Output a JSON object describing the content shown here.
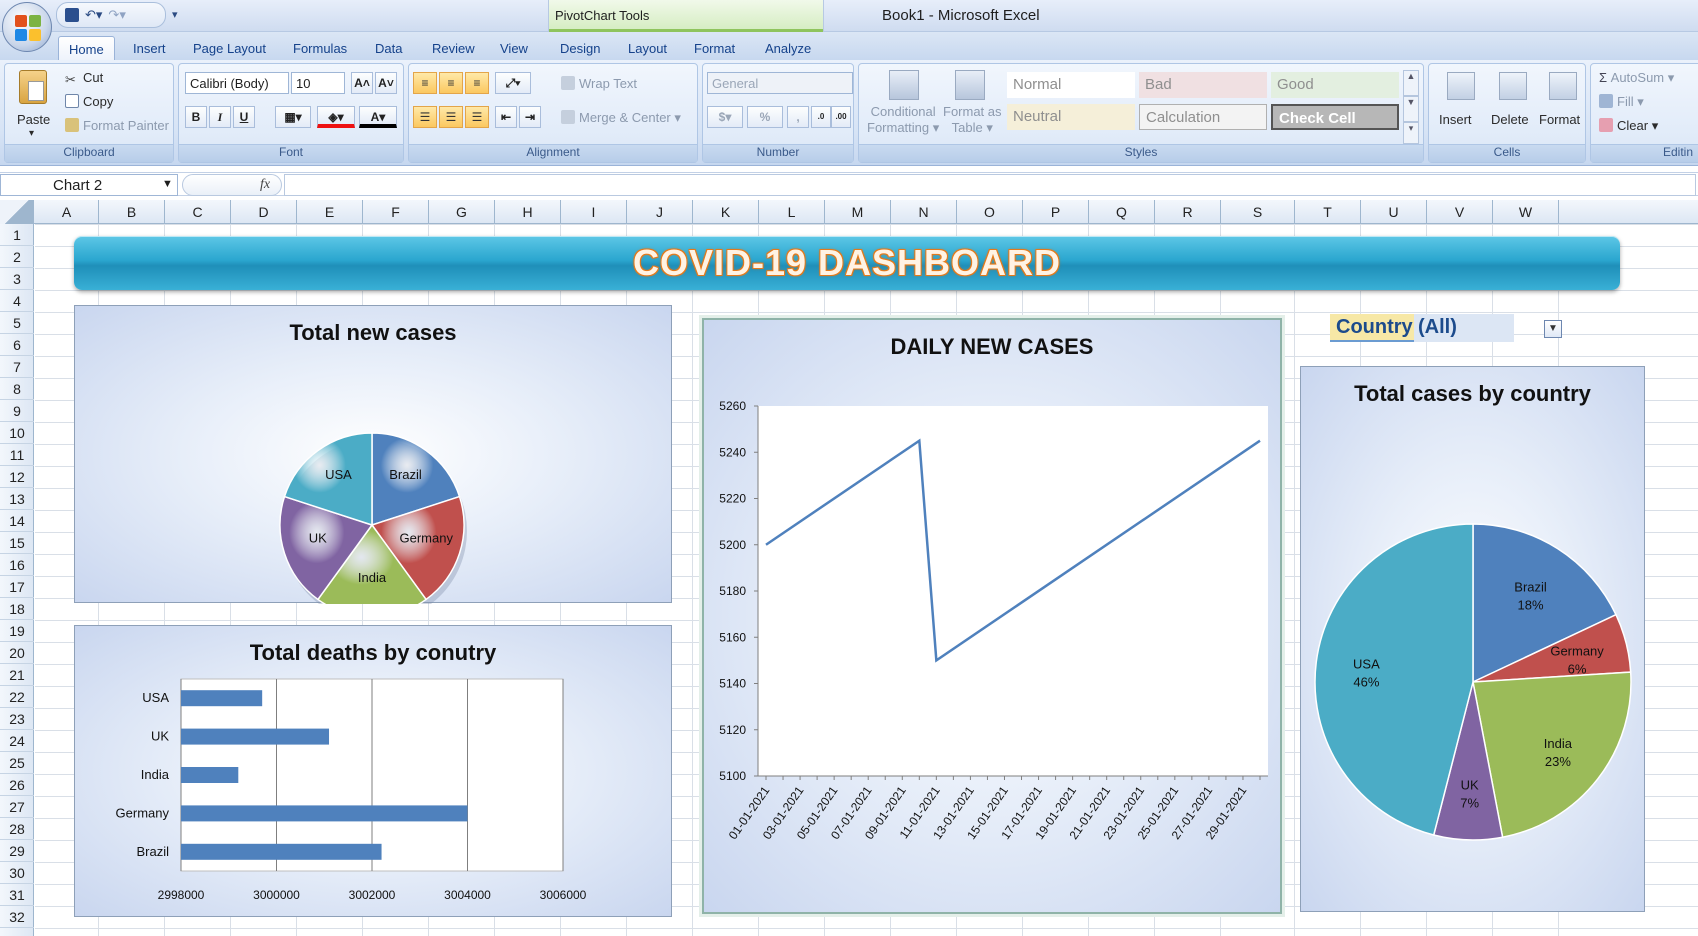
{
  "window": {
    "title": "Book1 - Microsoft Excel",
    "contextual_tools": "PivotChart Tools"
  },
  "tabs": [
    {
      "label": "Home",
      "active": true
    },
    {
      "label": "Insert"
    },
    {
      "label": "Page Layout"
    },
    {
      "label": "Formulas"
    },
    {
      "label": "Data"
    },
    {
      "label": "Review"
    },
    {
      "label": "View"
    },
    {
      "label": "Design"
    },
    {
      "label": "Layout"
    },
    {
      "label": "Format"
    },
    {
      "label": "Analyze"
    }
  ],
  "ribbon": {
    "clipboard": {
      "label": "Clipboard",
      "paste": "Paste",
      "cut": "Cut",
      "copy": "Copy",
      "format_painter": "Format Painter"
    },
    "font": {
      "label": "Font",
      "family": "Calibri (Body)",
      "size": "10",
      "bold": "B",
      "italic": "I",
      "underline": "U",
      "grow": "A˄",
      "shrink": "A˅"
    },
    "alignment": {
      "label": "Alignment",
      "wrap_text": "Wrap Text",
      "merge_center": "Merge & Center"
    },
    "number": {
      "label": "Number",
      "format": "General",
      "percent": "%"
    },
    "styles": {
      "label": "Styles",
      "conditional": [
        "Conditional",
        "Formatting"
      ],
      "format_table": [
        "Format as",
        "Table"
      ],
      "normal": "Normal",
      "bad": "Bad",
      "good": "Good",
      "neutral": "Neutral",
      "calculation": "Calculation",
      "check_cell": "Check Cell"
    },
    "cells": {
      "label": "Cells",
      "insert": "Insert",
      "delete": "Delete",
      "format": "Format"
    },
    "editing": {
      "label": "Editin",
      "autosum": "AutoSum",
      "fill": "Fill",
      "clear": "Clear"
    }
  },
  "formula_bar": {
    "name_box": "Chart 2",
    "fx": "fx"
  },
  "columns": [
    "A",
    "B",
    "C",
    "D",
    "E",
    "F",
    "G",
    "H",
    "I",
    "J",
    "K",
    "L",
    "M",
    "N",
    "O",
    "P",
    "Q",
    "R",
    "S",
    "T",
    "U",
    "V",
    "W"
  ],
  "rows": [
    "1",
    "2",
    "3",
    "4",
    "5",
    "6",
    "7",
    "8",
    "9",
    "10",
    "11",
    "12",
    "13",
    "14",
    "15",
    "16",
    "17",
    "18",
    "19",
    "20",
    "21",
    "22",
    "23",
    "24",
    "25",
    "26",
    "27",
    "28",
    "29",
    "30",
    "31",
    "32"
  ],
  "dashboard": {
    "title": "COVID-19 DASHBOARD"
  },
  "pivot_filter": {
    "field": "Country",
    "value": "(All)"
  },
  "chart_data": [
    {
      "type": "pie",
      "title": "Total new cases",
      "categories": [
        "Brazil",
        "Germany",
        "India",
        "UK",
        "USA"
      ],
      "values": [
        20,
        20,
        20,
        20,
        20
      ],
      "colors": [
        "#4f81bd",
        "#c0504d",
        "#9bbb59",
        "#8064a2",
        "#4bacc6"
      ]
    },
    {
      "type": "bar",
      "title": "Total deaths by conutry",
      "categories": [
        "Brazil",
        "Germany",
        "India",
        "UK",
        "USA"
      ],
      "values": [
        3002200,
        3004000,
        2999200,
        3001100,
        2999700
      ],
      "xlim": [
        2998000,
        3006000
      ],
      "xticks": [
        "2998000",
        "3000000",
        "3002000",
        "3004000",
        "3006000"
      ],
      "color": "#4f81bd"
    },
    {
      "type": "line",
      "title": "DAILY NEW CASES",
      "x": [
        "01-01-2021",
        "03-01-2021",
        "05-01-2021",
        "07-01-2021",
        "09-01-2021",
        "11-01-2021",
        "13-01-2021",
        "15-01-2021",
        "17-01-2021",
        "19-01-2021",
        "21-01-2021",
        "23-01-2021",
        "25-01-2021",
        "27-01-2021",
        "29-01-2021"
      ],
      "points": [
        {
          "x": 0,
          "y": 5200
        },
        {
          "x": 9,
          "y": 5245
        },
        {
          "x": 10,
          "y": 5150
        },
        {
          "x": 29,
          "y": 5245
        }
      ],
      "ylim": [
        5100,
        5260
      ],
      "yticks": [
        "5100",
        "5120",
        "5140",
        "5160",
        "5180",
        "5200",
        "5220",
        "5240",
        "5260"
      ],
      "color": "#4f81bd"
    },
    {
      "type": "pie",
      "title": "Total cases by country",
      "categories": [
        "Brazil",
        "Germany",
        "India",
        "UK",
        "USA"
      ],
      "values": [
        18,
        6,
        23,
        7,
        46
      ],
      "labels": [
        "18%",
        "6%",
        "23%",
        "7%",
        "46%"
      ],
      "colors": [
        "#4f81bd",
        "#c0504d",
        "#9bbb59",
        "#8064a2",
        "#4bacc6"
      ]
    }
  ]
}
